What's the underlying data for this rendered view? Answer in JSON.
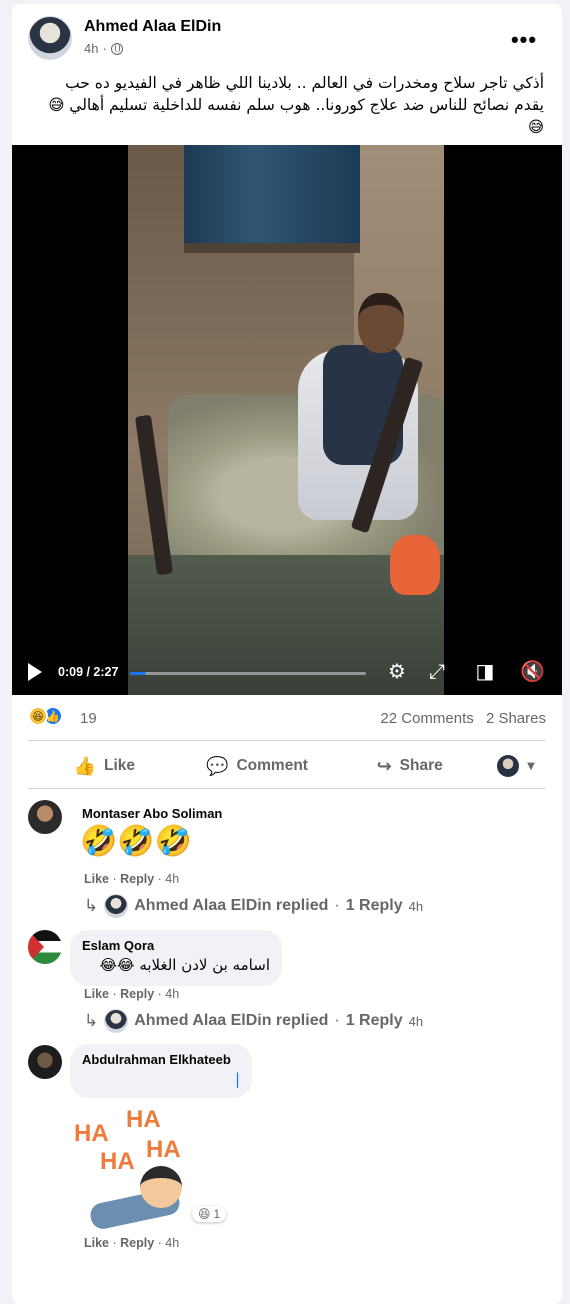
{
  "post": {
    "author": "Ahmed Alaa ElDin",
    "time": "4h",
    "text": "أذكي تاجر سلاح ومخدرات في العالم .. بلادينا اللي ظاهر في الفيديو ده حب يقدم نصائح للناس ضد علاج كورونا.. هوب سلم نفسه للداخلية تسليم أهالي 😅😅",
    "more_label": "•••"
  },
  "video": {
    "time": "0:09 / 2:27",
    "progress_fraction": 0.066,
    "icons": [
      "play-icon",
      "settings-icon",
      "fullscreen-icon",
      "pip-icon",
      "mute-icon"
    ]
  },
  "stats": {
    "reaction_count": "19",
    "comments": "22 Comments",
    "shares": "2 Shares"
  },
  "actions": {
    "like": "Like",
    "comment": "Comment",
    "share": "Share"
  },
  "comments": [
    {
      "name": "Montaser Abo Soliman",
      "text": "🤣🤣🤣",
      "like": "Like",
      "reply": "Reply",
      "time": "4h",
      "replied_by": "Ahmed Alaa ElDin replied",
      "reply_count": "1 Reply",
      "reply_time": "4h"
    },
    {
      "name": "Eslam Qora",
      "text": "اسامه بن لادن الغلابه 😂😂",
      "like": "Like",
      "reply": "Reply",
      "time": "4h",
      "replied_by": "Ahmed Alaa ElDin replied",
      "reply_count": "1 Reply",
      "reply_time": "4h"
    },
    {
      "name": "Abdulrahman Elkhateeb",
      "text": "|",
      "sticker_words": [
        "HA",
        "HA",
        "HA",
        "HA"
      ],
      "reaction_badge_count": "1",
      "like": "Like",
      "reply": "Reply",
      "time": "4h"
    }
  ],
  "colors": {
    "accent": "#1877f2",
    "muted": "#65676b",
    "background": "#f0f2f5"
  }
}
